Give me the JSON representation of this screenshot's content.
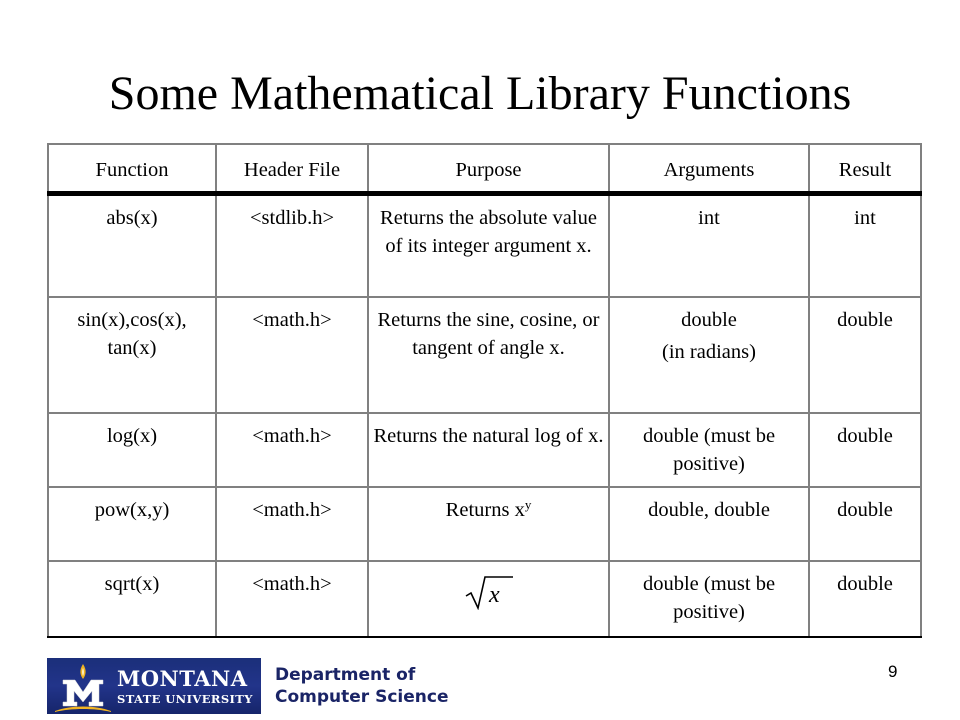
{
  "slide": {
    "title": "Some Mathematical Library Functions",
    "page_number": "9"
  },
  "table": {
    "headers": [
      "Function",
      "Header File",
      "Purpose",
      "Arguments",
      "Result"
    ],
    "rows": [
      {
        "function": "abs(x)",
        "header_file": "<stdlib.h>",
        "purpose": "Returns the absolute value of its integer argument x.",
        "arguments": [
          "int"
        ],
        "result": "int"
      },
      {
        "function": "sin(x),cos(x), tan(x)",
        "header_file": "<math.h>",
        "purpose": "Returns the sine, cosine, or tangent of angle x.",
        "arguments": [
          "double",
          "(in radians)"
        ],
        "result": "double"
      },
      {
        "function": "log(x)",
        "header_file": "<math.h>",
        "purpose": "Returns the natural log of x.",
        "arguments": [
          "double (must be positive)"
        ],
        "result": "double"
      },
      {
        "function": "pow(x,y)",
        "header_file": "<math.h>",
        "purpose": "Returns x",
        "purpose_superscript": "y",
        "arguments": [
          "double, double"
        ],
        "result": "double"
      },
      {
        "function": "sqrt(x)",
        "header_file": "<math.h>",
        "purpose_formula": "√x",
        "purpose_radicand": "x",
        "arguments": [
          "double (must be positive)"
        ],
        "result": "double"
      }
    ]
  },
  "footer": {
    "logo": {
      "icon": "msu-m-emblem-icon",
      "name": "MONTANA",
      "subname": "STATE UNIVERSITY",
      "background_color": "#1f3284",
      "accent_color": "#f0b323"
    },
    "department_line1": "Department of",
    "department_line2": "Computer Science",
    "department_color": "#1a2466"
  }
}
